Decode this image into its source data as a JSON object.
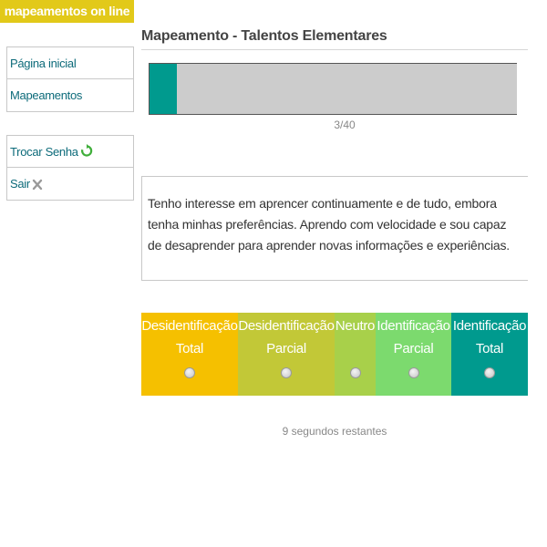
{
  "brand": {
    "label": "mapeamentos on line",
    "color": "#e2c919"
  },
  "sidebar": {
    "main_items": [
      {
        "label": "Página inicial"
      },
      {
        "label": "Mapeamentos"
      }
    ],
    "user_items": [
      {
        "label": "Trocar Senha",
        "icon": "refresh-icon"
      },
      {
        "label": "Sair",
        "icon": "close-icon"
      }
    ]
  },
  "page": {
    "title": "Mapeamento - Talentos Elementares"
  },
  "progress": {
    "current": 3,
    "total": 40,
    "label": "3/40",
    "fill_color": "#009a8e"
  },
  "statement": {
    "text": "Tenho interesse em aprencer continuamente e de tudo, embora tenha minhas preferências. Aprendo com velocidade e sou capaz de desaprender para aprender novas informações e experiências."
  },
  "options": [
    {
      "line1": "Desidentificação",
      "line2": "Total",
      "color": "#f5c000"
    },
    {
      "line1": "Desidentificação",
      "line2": "Parcial",
      "color": "#c2c837"
    },
    {
      "line1": "Neutro",
      "line2": "",
      "color": "#a8d04a"
    },
    {
      "line1": "Identificação",
      "line2": "Parcial",
      "color": "#7cda6e"
    },
    {
      "line1": "Identificação",
      "line2": "Total",
      "color": "#009a8e"
    }
  ],
  "timer": {
    "text": "9 segundos restantes"
  }
}
